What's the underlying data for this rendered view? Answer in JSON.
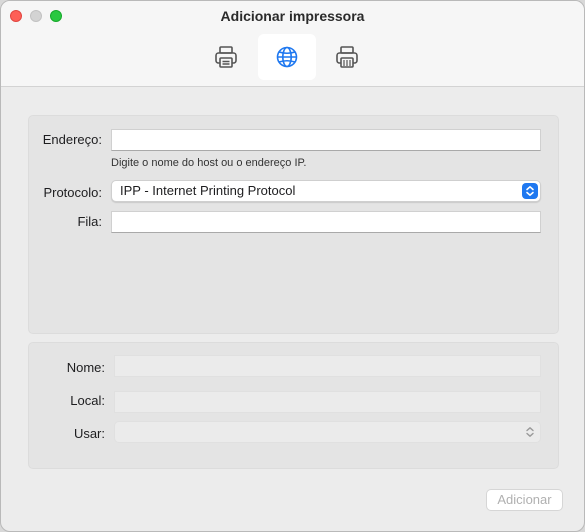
{
  "window": {
    "title": "Adicionar impressora"
  },
  "toolbar": {
    "tabs": [
      {
        "name": "default-printer",
        "icon": "printer-icon",
        "selected": false
      },
      {
        "name": "ip",
        "icon": "globe-icon",
        "selected": true
      },
      {
        "name": "windows",
        "icon": "printer-network-icon",
        "selected": false
      }
    ]
  },
  "form": {
    "address": {
      "label": "Endereço:",
      "value": "",
      "hint": "Digite o nome do host ou o endereço IP."
    },
    "protocol": {
      "label": "Protocolo:",
      "value": "IPP - Internet Printing Protocol"
    },
    "queue": {
      "label": "Fila:",
      "value": ""
    }
  },
  "details": {
    "name": {
      "label": "Nome:",
      "value": ""
    },
    "location": {
      "label": "Local:",
      "value": ""
    },
    "use": {
      "label": "Usar:",
      "value": ""
    }
  },
  "footer": {
    "add_label": "Adicionar"
  },
  "colors": {
    "accent": "#1f78f0",
    "close": "#fe5f57",
    "zoom": "#29c840"
  }
}
